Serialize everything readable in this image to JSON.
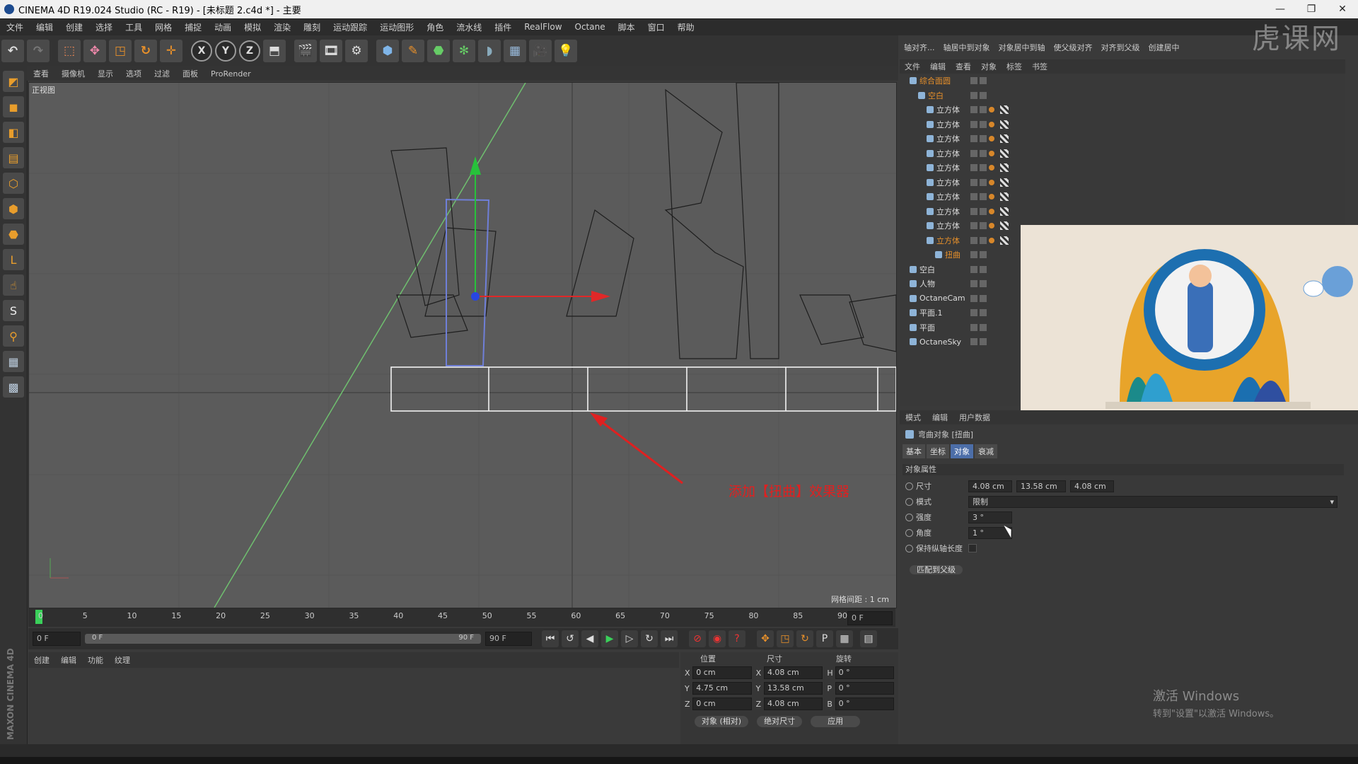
{
  "window": {
    "title": "CINEMA 4D R19.024 Studio (RC - R19) - [未标题 2.c4d *] - 主要",
    "controls": [
      "—",
      "❐",
      "✕"
    ]
  },
  "menubar": [
    "文件",
    "编辑",
    "创建",
    "选择",
    "工具",
    "网格",
    "捕捉",
    "动画",
    "模拟",
    "渲染",
    "雕刻",
    "运动跟踪",
    "运动图形",
    "角色",
    "流水线",
    "插件",
    "RealFlow",
    "Octane",
    "脚本",
    "窗口",
    "帮助"
  ],
  "toolbar": {
    "axis_labels": [
      "X",
      "Y",
      "Z"
    ]
  },
  "viewport": {
    "menu": [
      "查看",
      "摄像机",
      "显示",
      "选项",
      "过滤",
      "面板",
      "ProRender"
    ],
    "view_name": "正视图",
    "grid_spacing": "网格间距 : 1 cm",
    "annotation": "添加【扭曲】效果器"
  },
  "timeline": {
    "ticks": [
      "0",
      "5",
      "10",
      "15",
      "20",
      "25",
      "30",
      "35",
      "40",
      "45",
      "50",
      "55",
      "60",
      "65",
      "70",
      "75",
      "80",
      "85",
      "90"
    ],
    "current_frame_right": "0 F",
    "start_field": "0 F",
    "range_start": "0 F",
    "range_end": "90 F",
    "end_field": "90 F"
  },
  "material_manager": {
    "menu": [
      "创建",
      "编辑",
      "功能",
      "纹理"
    ]
  },
  "coords": {
    "headers": [
      "位置",
      "尺寸",
      "旋转"
    ],
    "rows": [
      {
        "axis": "X",
        "pos": "0 cm",
        "size_axis": "X",
        "size": "4.08 cm",
        "rot_axis": "H",
        "rot": "0 °"
      },
      {
        "axis": "Y",
        "pos": "4.75 cm",
        "size_axis": "Y",
        "size": "13.58 cm",
        "rot_axis": "P",
        "rot": "0 °"
      },
      {
        "axis": "Z",
        "pos": "0 cm",
        "size_axis": "Z",
        "size": "4.08 cm",
        "rot_axis": "B",
        "rot": "0 °"
      }
    ],
    "mode_object": "对象 (相对)",
    "mode_size": "绝对尺寸",
    "apply": "应用"
  },
  "right_toolbar": [
    "轴对齐...",
    "轴居中到对象",
    "对象居中到轴",
    "使父级对齐",
    "对齐到父级",
    "创建居中"
  ],
  "object_manager": {
    "menu": [
      "文件",
      "编辑",
      "查看",
      "对象",
      "标签",
      "书签"
    ],
    "items": [
      {
        "name": "综合面圆",
        "selected": true,
        "indent": 0
      },
      {
        "name": "空白",
        "selected": true,
        "indent": 1
      },
      {
        "name": "立方体",
        "selected": false,
        "indent": 2
      },
      {
        "name": "立方体",
        "selected": false,
        "indent": 2
      },
      {
        "name": "立方体",
        "selected": false,
        "indent": 2
      },
      {
        "name": "立方体",
        "selected": false,
        "indent": 2
      },
      {
        "name": "立方体",
        "selected": false,
        "indent": 2
      },
      {
        "name": "立方体",
        "selected": false,
        "indent": 2
      },
      {
        "name": "立方体",
        "selected": false,
        "indent": 2
      },
      {
        "name": "立方体",
        "selected": false,
        "indent": 2
      },
      {
        "name": "立方体",
        "selected": false,
        "indent": 2
      },
      {
        "name": "立方体",
        "selected": true,
        "indent": 2
      },
      {
        "name": "扭曲",
        "selected": true,
        "indent": 3
      },
      {
        "name": "空白",
        "selected": false,
        "indent": 0
      },
      {
        "name": "人物",
        "selected": false,
        "indent": 0
      },
      {
        "name": "OctaneCam",
        "selected": false,
        "indent": 0
      },
      {
        "name": "平面.1",
        "selected": false,
        "indent": 0
      },
      {
        "name": "平面",
        "selected": false,
        "indent": 0
      },
      {
        "name": "OctaneSky",
        "selected": false,
        "indent": 0
      }
    ]
  },
  "attributes": {
    "menu": [
      "模式",
      "编辑",
      "用户数据"
    ],
    "object_title": "弯曲对象 [扭曲]",
    "tabs": [
      "基本",
      "坐标",
      "对象",
      "衰减"
    ],
    "active_tab": "对象",
    "section": "对象属性",
    "size_label": "尺寸",
    "size_values": [
      "4.08 cm",
      "13.58 cm",
      "4.08 cm"
    ],
    "mode_label": "模式",
    "mode_value": "限制",
    "strength_label": "强度",
    "strength_value": "3 °",
    "angle_label": "角度",
    "angle_value": "1 °",
    "keep_length_label": "保持纵轴长度",
    "match_parent": "匹配到父级"
  },
  "watermark": {
    "line1": "激活 Windows",
    "line2": "转到\"设置\"以激活 Windows。"
  },
  "logo_text": "虎课网"
}
